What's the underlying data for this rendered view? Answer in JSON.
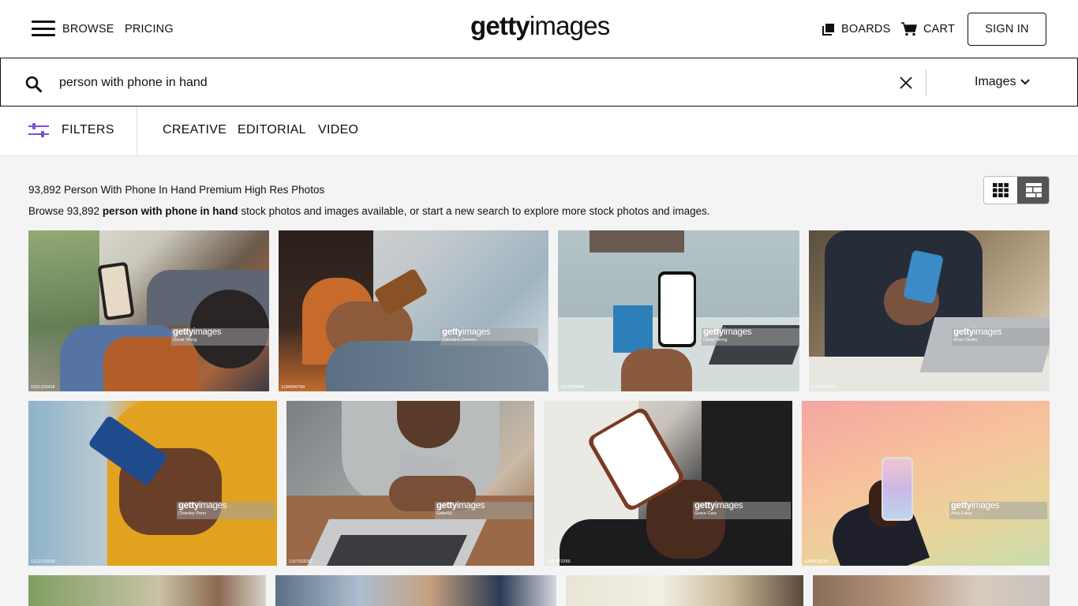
{
  "header": {
    "nav_browse": "BROWSE",
    "nav_pricing": "PRICING",
    "logo_bold": "getty",
    "logo_light": "images",
    "boards": "BOARDS",
    "cart": "CART",
    "sign_in": "SIGN IN"
  },
  "search": {
    "query": "person with phone in hand",
    "media_type": "Images"
  },
  "filterbar": {
    "filters_label": "FILTERS",
    "tabs": [
      "CREATIVE",
      "EDITORIAL",
      "VIDEO"
    ]
  },
  "results": {
    "title": "93,892 Person With Phone In Hand Premium High Res Photos",
    "sub_prefix": "Browse 93,892 ",
    "sub_bold": "person with phone in hand",
    "sub_suffix": " stock photos and images available, or start a new search to explore more stock photos and images."
  },
  "tiles": [
    {
      "id": "1321329418",
      "credit": "Oscar Wong"
    },
    {
      "id": "1194900794",
      "credit": "Delmaine Donson"
    },
    {
      "id": "1307699640",
      "credit": "Oscar Wong"
    },
    {
      "id": "1185932621",
      "credit": "Moyo Studio"
    },
    {
      "id": "1312133539",
      "credit": "Chardey Penn"
    },
    {
      "id": "1167533282",
      "credit": "Gabe65"
    },
    {
      "id": "1282472269",
      "credit": "Grace Cary"
    },
    {
      "id": "1259418635",
      "credit": "Antu Esbar"
    }
  ],
  "watermark": {
    "bold": "getty",
    "light": "images"
  },
  "colors": {
    "accent_purple": "#7b4fd6",
    "toggle_active": "#555555"
  },
  "icons": [
    "menu-icon",
    "search-icon",
    "close-icon",
    "chevron-down-icon",
    "filter-sliders-icon",
    "boards-icon",
    "cart-icon",
    "grid-view-icon",
    "mosaic-view-icon"
  ]
}
